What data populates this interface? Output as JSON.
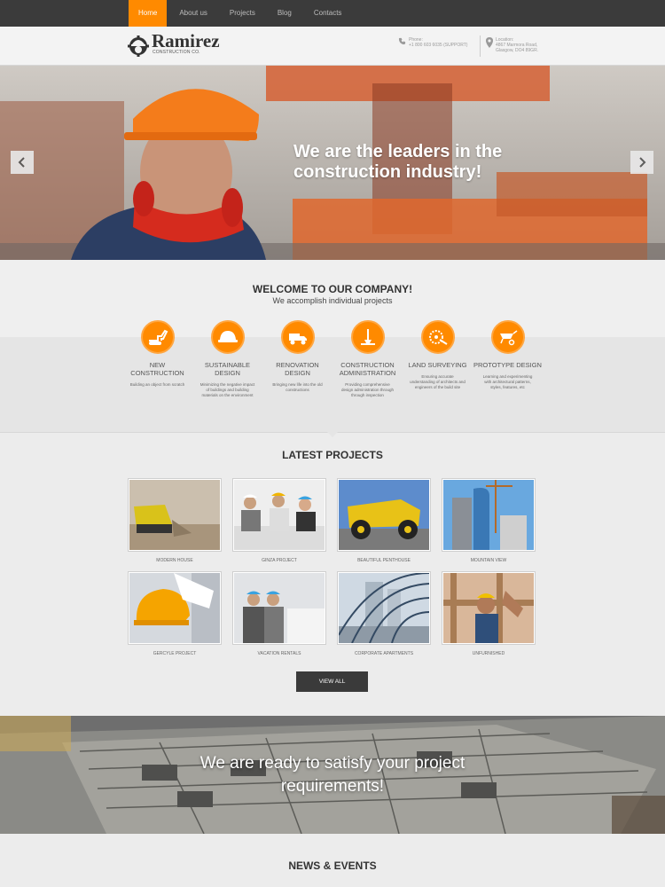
{
  "nav": {
    "items": [
      {
        "label": "Home",
        "active": true
      },
      {
        "label": "About us",
        "active": false
      },
      {
        "label": "Projects",
        "active": false
      },
      {
        "label": "Blog",
        "active": false
      },
      {
        "label": "Contacts",
        "active": false
      }
    ]
  },
  "header": {
    "logo_name": "Ramirez",
    "logo_sub": "CONSTRUCTION CO.",
    "phone_label": "Phone:",
    "phone_value": "+1 800 603 6035 (SUPPORT)",
    "location_label": "Location:",
    "location_line1": "4867 Marmora Road,",
    "location_line2": "Glasgow, DO4 89GR."
  },
  "hero": {
    "title": "We are the leaders in the construction industry!"
  },
  "welcome": {
    "title": "WELCOME TO OUR COMPANY!",
    "subtitle": "We accomplish individual projects",
    "services": [
      {
        "title": "NEW CONSTRUCTION",
        "desc": "Building an object from scratch",
        "icon": "excavator-icon"
      },
      {
        "title": "SUSTAINABLE DESIGN",
        "desc": "Minimizing the negative impact of buildings and building materials on the environment",
        "icon": "hardhat-icon"
      },
      {
        "title": "RENOVATION DESIGN",
        "desc": "Bringing new life into the old constructions",
        "icon": "truck-icon"
      },
      {
        "title": "CONSTRUCTION ADMINISTRATION",
        "desc": "Providing comprehensive design administration through through inspection",
        "icon": "crane-icon"
      },
      {
        "title": "LAND SURVEYING",
        "desc": "Ensuring accurate understanding of architects and engineers of the build site",
        "icon": "saw-icon"
      },
      {
        "title": "PROTOTYPE DESIGN",
        "desc": "Learning and experimenting with architectural patterns, styles, features, etc",
        "icon": "wheelbarrow-icon"
      }
    ]
  },
  "projects": {
    "title": "LATEST PROJECTS",
    "items": [
      {
        "caption": "MODERN HOUSE"
      },
      {
        "caption": "GINZA PROJECT"
      },
      {
        "caption": "BEAUTIFUL PENTHOUSE"
      },
      {
        "caption": "MOUNTAIN VIEW"
      },
      {
        "caption": "GERCYLE PROJECT"
      },
      {
        "caption": "VACATION RENTALS"
      },
      {
        "caption": "CORPORATE APARTMENTS"
      },
      {
        "caption": "UNFURNISHED"
      }
    ],
    "view_all": "VIEW ALL"
  },
  "banner": {
    "title": "We are ready to satisfy your project requirements!"
  },
  "news": {
    "title": "NEWS & EVENTS"
  },
  "colors": {
    "accent": "#ff8a00",
    "topbar": "#3b3b3b",
    "button": "#3a3a3a"
  }
}
